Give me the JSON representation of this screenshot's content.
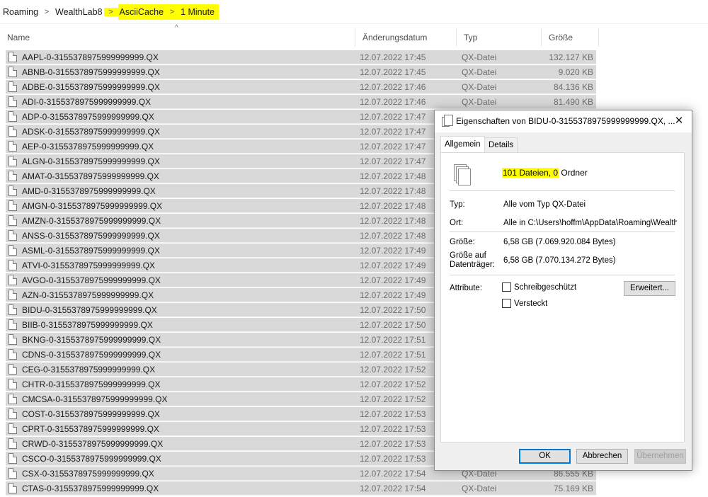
{
  "breadcrumb": {
    "items": [
      "Roaming",
      "WealthLab8",
      "AsciiCache",
      "1 Minute"
    ],
    "separator": ">"
  },
  "columns": {
    "name": "Name",
    "date": "Änderungsdatum",
    "type": "Typ",
    "size": "Größe"
  },
  "files": [
    {
      "name": "AAPL-0-3155378975999999999.QX",
      "date": "12.07.2022 17:45",
      "type": "QX-Datei",
      "size": "132.127 KB"
    },
    {
      "name": "ABNB-0-3155378975999999999.QX",
      "date": "12.07.2022 17:45",
      "type": "QX-Datei",
      "size": "9.020 KB"
    },
    {
      "name": "ADBE-0-3155378975999999999.QX",
      "date": "12.07.2022 17:46",
      "type": "QX-Datei",
      "size": "84.136 KB"
    },
    {
      "name": "ADI-0-3155378975999999999.QX",
      "date": "12.07.2022 17:46",
      "type": "QX-Datei",
      "size": "81.490 KB"
    },
    {
      "name": "ADP-0-3155378975999999999.QX",
      "date": "12.07.2022 17:47",
      "type": "",
      "size": ""
    },
    {
      "name": "ADSK-0-3155378975999999999.QX",
      "date": "12.07.2022 17:47",
      "type": "",
      "size": ""
    },
    {
      "name": "AEP-0-3155378975999999999.QX",
      "date": "12.07.2022 17:47",
      "type": "",
      "size": ""
    },
    {
      "name": "ALGN-0-3155378975999999999.QX",
      "date": "12.07.2022 17:47",
      "type": "",
      "size": ""
    },
    {
      "name": "AMAT-0-3155378975999999999.QX",
      "date": "12.07.2022 17:48",
      "type": "",
      "size": ""
    },
    {
      "name": "AMD-0-3155378975999999999.QX",
      "date": "12.07.2022 17:48",
      "type": "",
      "size": ""
    },
    {
      "name": "AMGN-0-3155378975999999999.QX",
      "date": "12.07.2022 17:48",
      "type": "",
      "size": ""
    },
    {
      "name": "AMZN-0-3155378975999999999.QX",
      "date": "12.07.2022 17:48",
      "type": "",
      "size": ""
    },
    {
      "name": "ANSS-0-3155378975999999999.QX",
      "date": "12.07.2022 17:48",
      "type": "",
      "size": ""
    },
    {
      "name": "ASML-0-3155378975999999999.QX",
      "date": "12.07.2022 17:49",
      "type": "",
      "size": ""
    },
    {
      "name": "ATVI-0-3155378975999999999.QX",
      "date": "12.07.2022 17:49",
      "type": "",
      "size": ""
    },
    {
      "name": "AVGO-0-3155378975999999999.QX",
      "date": "12.07.2022 17:49",
      "type": "",
      "size": ""
    },
    {
      "name": "AZN-0-3155378975999999999.QX",
      "date": "12.07.2022 17:49",
      "type": "",
      "size": ""
    },
    {
      "name": "BIDU-0-3155378975999999999.QX",
      "date": "12.07.2022 17:50",
      "type": "",
      "size": ""
    },
    {
      "name": "BIIB-0-3155378975999999999.QX",
      "date": "12.07.2022 17:50",
      "type": "",
      "size": ""
    },
    {
      "name": "BKNG-0-3155378975999999999.QX",
      "date": "12.07.2022 17:51",
      "type": "",
      "size": ""
    },
    {
      "name": "CDNS-0-3155378975999999999.QX",
      "date": "12.07.2022 17:51",
      "type": "",
      "size": ""
    },
    {
      "name": "CEG-0-3155378975999999999.QX",
      "date": "12.07.2022 17:52",
      "type": "",
      "size": ""
    },
    {
      "name": "CHTR-0-3155378975999999999.QX",
      "date": "12.07.2022 17:52",
      "type": "",
      "size": ""
    },
    {
      "name": "CMCSA-0-3155378975999999999.QX",
      "date": "12.07.2022 17:52",
      "type": "",
      "size": ""
    },
    {
      "name": "COST-0-3155378975999999999.QX",
      "date": "12.07.2022 17:53",
      "type": "",
      "size": ""
    },
    {
      "name": "CPRT-0-3155378975999999999.QX",
      "date": "12.07.2022 17:53",
      "type": "",
      "size": ""
    },
    {
      "name": "CRWD-0-3155378975999999999.QX",
      "date": "12.07.2022 17:53",
      "type": "",
      "size": ""
    },
    {
      "name": "CSCO-0-3155378975999999999.QX",
      "date": "12.07.2022 17:53",
      "type": "",
      "size": ""
    },
    {
      "name": "CSX-0-3155378975999999999.QX",
      "date": "12.07.2022 17:54",
      "type": "QX-Datei",
      "size": "86.555 KB"
    },
    {
      "name": "CTAS-0-3155378975999999999.QX",
      "date": "12.07.2022 17:54",
      "type": "QX-Datei",
      "size": "75.169 KB"
    }
  ],
  "dialog": {
    "title": "Eigenschaften von BIDU-0-3155378975999999999.QX, ...",
    "close_glyph": "✕",
    "tabs": [
      "Allgemein",
      "Details"
    ],
    "summary_highlight": "101 Dateien, 0",
    "summary_rest": " Ordner",
    "type_label": "Typ:",
    "type_value": "Alle vom Typ QX-Datei",
    "location_label": "Ort:",
    "location_value": "Alle in C:\\Users\\hoffm\\AppData\\Roaming\\WealthLab",
    "size_label": "Größe:",
    "size_value": "6,58 GB (7.069.920.084 Bytes)",
    "disk_size_label_line1": "Größe auf",
    "disk_size_label_line2": "Datenträger:",
    "disk_size_value": "6,58 GB (7.070.134.272 Bytes)",
    "attributes_label": "Attribute:",
    "readonly_label": "Schreibgeschützt",
    "hidden_label": "Versteckt",
    "advanced_button": "Erweitert...",
    "ok_button": "OK",
    "cancel_button": "Abbrechen",
    "apply_button": "Übernehmen"
  },
  "colors": {
    "highlight": "#ffff00",
    "selection": "#d9d9d9",
    "accent": "#0078d7"
  }
}
